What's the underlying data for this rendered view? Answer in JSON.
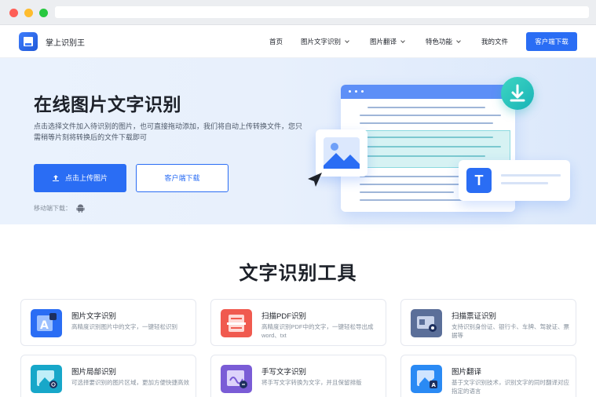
{
  "header": {
    "brand": "掌上识别王",
    "nav": [
      {
        "label": "首页",
        "has_dropdown": false
      },
      {
        "label": "图片文字识别",
        "has_dropdown": true
      },
      {
        "label": "图片翻译",
        "has_dropdown": true
      },
      {
        "label": "特色功能",
        "has_dropdown": true
      },
      {
        "label": "我的文件",
        "has_dropdown": false
      }
    ],
    "download_button": "客户端下载"
  },
  "hero": {
    "title": "在线图片文字识别",
    "description": "点击选择文件加入待识别的图片，也可直接拖动添加，我们将自动上传转换文件，您只需稍等片刻将转换后的文件下载即可",
    "upload_button": "点击上传图片",
    "client_button": "客户端下载",
    "mobile_label": "移动端下载："
  },
  "tools": {
    "title": "文字识别工具",
    "items": [
      {
        "title": "图片文字识别",
        "desc": "高精度识别图片中的文字，一键轻松识别",
        "icon": "image-text-icon",
        "color": "#2a6df4"
      },
      {
        "title": "扫描PDF识别",
        "desc": "高精度识别PDF中的文字，一键轻松导出成word、txt",
        "icon": "pdf-scan-icon",
        "color": "#f05a4f"
      },
      {
        "title": "扫描票证识别",
        "desc": "支持识别身份证、银行卡、车牌、驾驶证、票据等",
        "icon": "id-card-scan-icon",
        "color": "#5b6f99"
      },
      {
        "title": "图片局部识别",
        "desc": "可选择要识别的图片区域，更加方便快捷高效",
        "icon": "region-scan-icon",
        "color": "#17a7c9"
      },
      {
        "title": "手写文字识别",
        "desc": "将手写文字转换为文字，并且保留排版",
        "icon": "handwriting-icon",
        "color": "#7a5cd6"
      },
      {
        "title": "图片翻译",
        "desc": "基于文字识别技术，识别文字的同时翻译对应指定的语言",
        "icon": "image-translate-icon",
        "color": "#2a8af4"
      }
    ]
  }
}
